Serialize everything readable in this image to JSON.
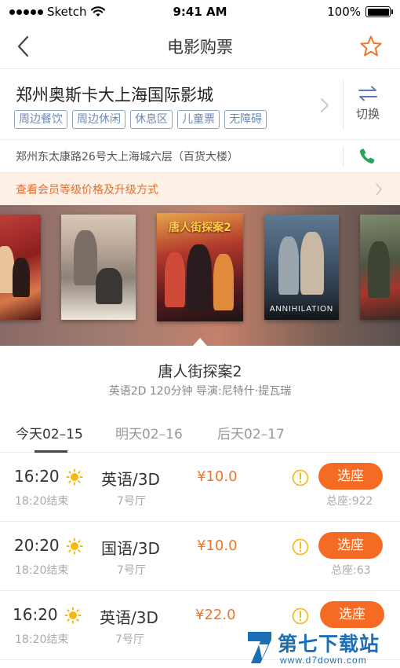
{
  "status_bar": {
    "carrier": "Sketch",
    "time": "9:41 AM",
    "battery": "100%",
    "battery_level": 1.0
  },
  "nav": {
    "title": "电影购票",
    "back_icon": "chevron-left-icon",
    "favorite_icon": "star-icon"
  },
  "cinema": {
    "name": "郑州奥斯卡大上海国际影城",
    "tags": [
      "周边餐饮",
      "周边休闲",
      "休息区",
      "儿童票",
      "无障碍"
    ],
    "switch_label": "切换",
    "address": "郑州东太康路26号大上海城六层（百货大楼）"
  },
  "member_banner": {
    "text": "查看会员等级价格及升级方式"
  },
  "posters": {
    "items": [
      {
        "title_art": "",
        "caption": ""
      },
      {
        "title_art": "",
        "caption": ""
      },
      {
        "title_art": "唐人街探案2",
        "caption": ""
      },
      {
        "title_art": "",
        "caption": "ANNIHILATION"
      },
      {
        "title_art": "",
        "caption": ""
      }
    ]
  },
  "movie": {
    "title": "唐人街探案2",
    "meta": "英语2D 120分钟 导演:尼特什·提瓦瑞"
  },
  "date_tabs": [
    {
      "label": "今天02–15",
      "active": true
    },
    {
      "label": "明天02–16",
      "active": false
    },
    {
      "label": "后天02–17",
      "active": false
    }
  ],
  "showtimes": [
    {
      "start": "16:20",
      "end": "18:20结束",
      "lang": "英语/3D",
      "hall": "7号厅",
      "price": "¥10.0",
      "button": "选座",
      "seats": "总座:922"
    },
    {
      "start": "20:20",
      "end": "18:20结束",
      "lang": "国语/3D",
      "hall": "7号厅",
      "price": "¥10.0",
      "button": "选座",
      "seats": "总座:63"
    },
    {
      "start": "16:20",
      "end": "18:20结束",
      "lang": "英语/3D",
      "hall": "7号厅",
      "price": "¥22.0",
      "button": "选座",
      "seats": ""
    }
  ],
  "watermark": {
    "title": "第七下载站",
    "url": "www.d7down.com"
  },
  "colors": {
    "accent": "#f66b23",
    "price": "#f07528",
    "tag_border": "#8da4c6",
    "member_bg": "#fdf0e6",
    "phone_icon": "#2aa35d",
    "sun_icon": "#f5b80c"
  }
}
